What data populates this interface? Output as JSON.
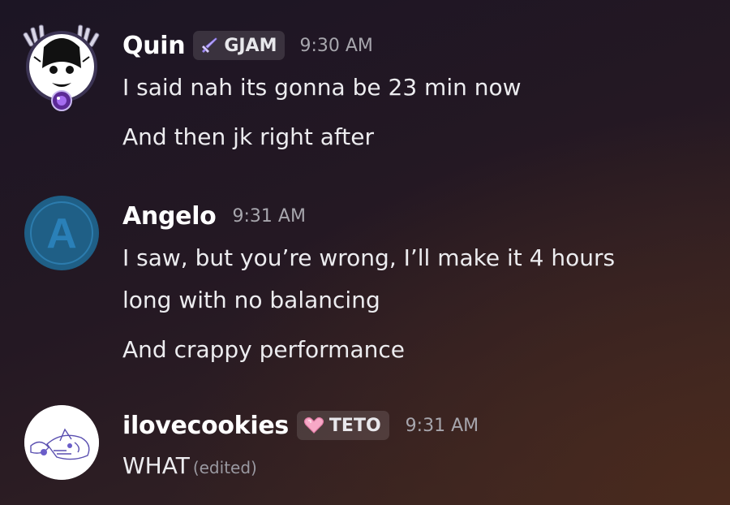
{
  "messages": [
    {
      "username": "Quin",
      "tag": "GJAM",
      "tag_icon": "sword-icon",
      "time": "9:30 AM",
      "lines": [
        "I said nah its gonna be 23 min now",
        "And then jk right after"
      ]
    },
    {
      "username": "Angelo",
      "avatar_letter": "A",
      "time": "9:31 AM",
      "lines": [
        "I saw, but you’re wrong, I’ll make it 4 hours",
        "long with no balancing",
        "And crappy performance"
      ]
    },
    {
      "username": "ilovecookies",
      "tag": "TETO",
      "tag_icon": "heart-icon",
      "time": "9:31 AM",
      "lines": [
        "WHAT"
      ],
      "edited_label": "(edited)"
    }
  ],
  "colors": {
    "username": "#ffffff",
    "text": "#ececef",
    "timestamp": "#a7a6ad",
    "angelo_avatar": "#1f5f86"
  }
}
